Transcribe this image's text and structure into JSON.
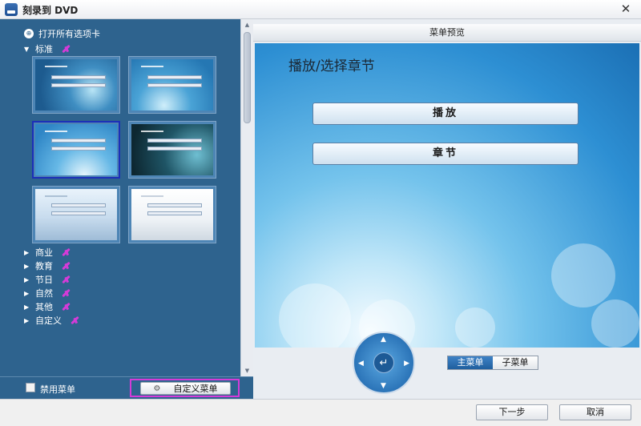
{
  "window": {
    "title": "刻录到 DVD",
    "close_glyph": "✕"
  },
  "left_panel": {
    "open_all_label": "打开所有选项卡",
    "categories": [
      {
        "label": "标准",
        "expanded": true
      },
      {
        "label": "商业",
        "expanded": false
      },
      {
        "label": "教育",
        "expanded": false
      },
      {
        "label": "节日",
        "expanded": false
      },
      {
        "label": "自然",
        "expanded": false
      },
      {
        "label": "其他",
        "expanded": false
      },
      {
        "label": "自定义",
        "expanded": false
      }
    ],
    "expanded_glyph": "▼",
    "collapsed_glyph": "▶",
    "selected_template_index": 2,
    "disable_menu_label": "禁用菜单",
    "disable_menu_checked": false,
    "custom_menu_label": "自定义菜单"
  },
  "preview": {
    "header": "菜单预览",
    "title": "播放/选择章节",
    "buttons": [
      "播放",
      "章节"
    ],
    "nav_center_glyph": "↵",
    "tabs": [
      {
        "label": "主菜单",
        "active": true
      },
      {
        "label": "子菜单",
        "active": false
      }
    ]
  },
  "footer": {
    "next_label": "下一步",
    "cancel_label": "取消"
  },
  "colors": {
    "left_bg": "#2e638e",
    "check_mark": "#d43bd8",
    "selected_border": "#1c2fb8"
  }
}
